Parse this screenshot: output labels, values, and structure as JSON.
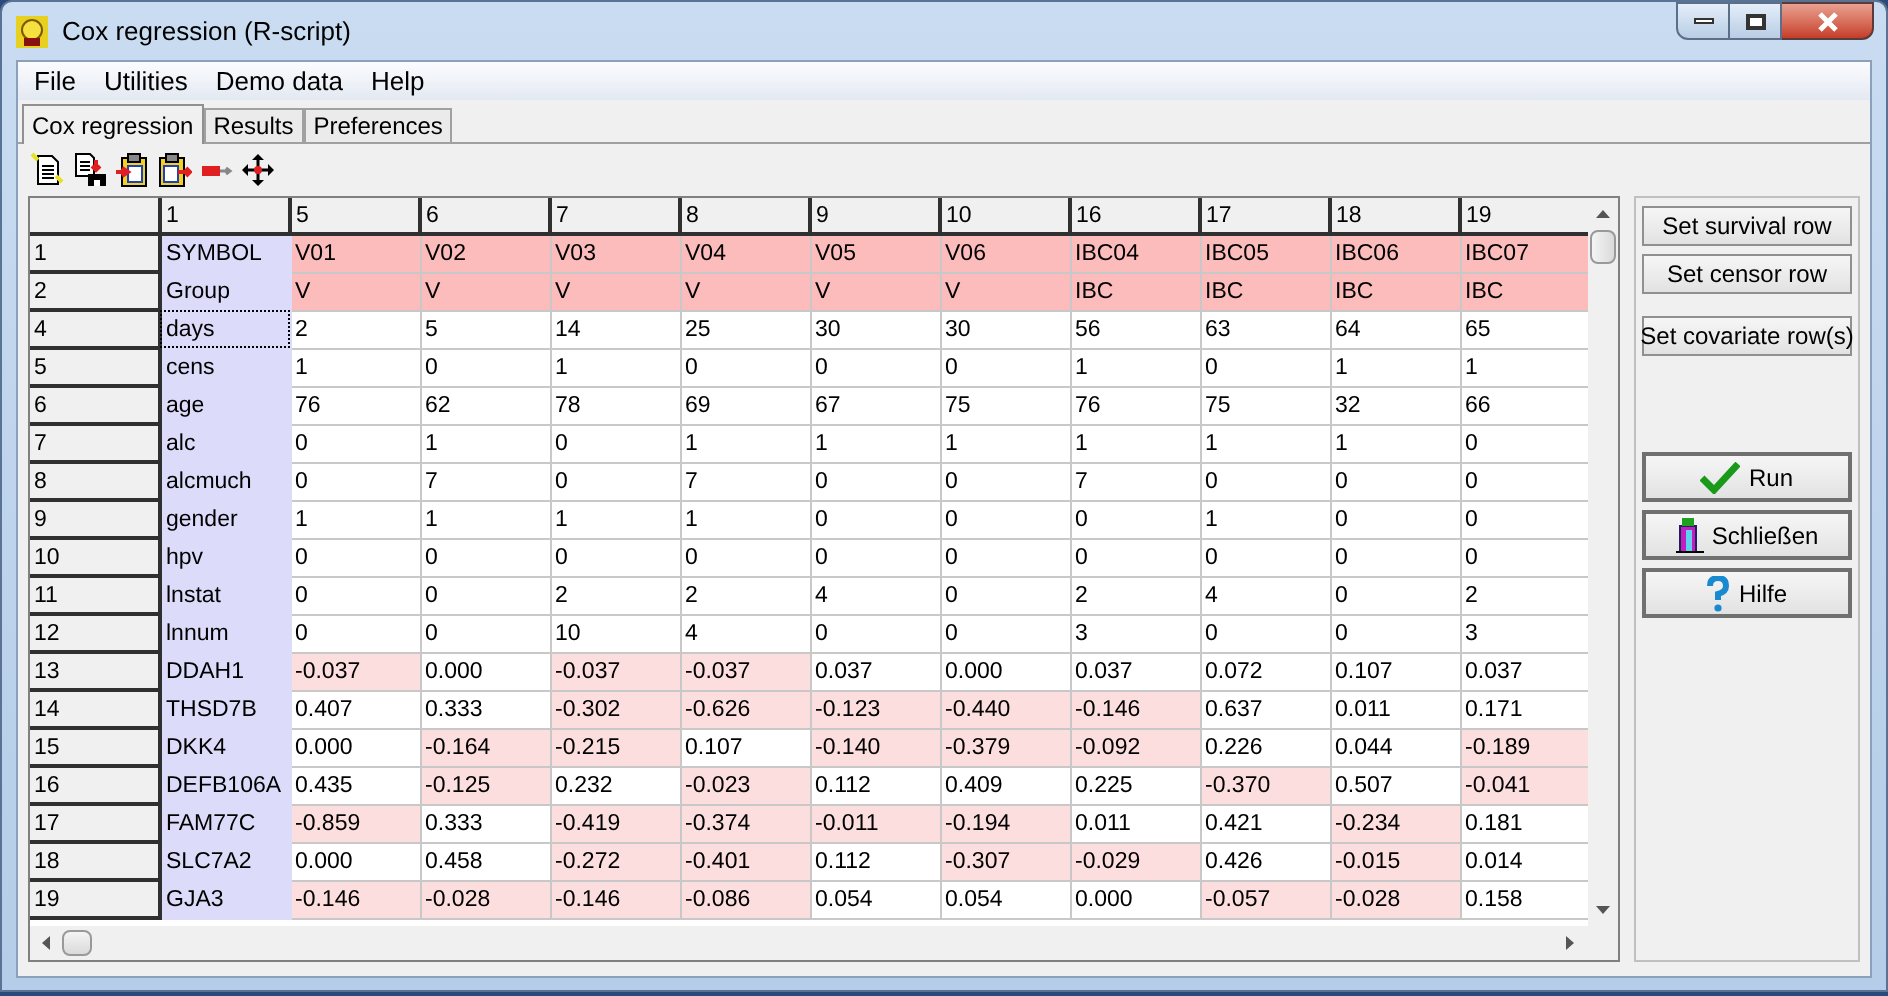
{
  "window": {
    "title": "Cox regression (R-script)"
  },
  "menu": [
    "File",
    "Utilities",
    "Demo data",
    "Help"
  ],
  "tabs": [
    {
      "label": "Cox regression",
      "selected": true
    },
    {
      "label": "Results",
      "selected": false
    },
    {
      "label": "Preferences",
      "selected": false
    }
  ],
  "grid": {
    "columns": [
      "1",
      "5",
      "6",
      "7",
      "8",
      "9",
      "10",
      "16",
      "17",
      "18",
      "19"
    ],
    "rows": [
      {
        "number": "1",
        "kind": "label",
        "cells": [
          "SYMBOL",
          "V01",
          "V02",
          "V03",
          "V04",
          "V05",
          "V06",
          "IBC04",
          "IBC05",
          "IBC06",
          "IBC07"
        ]
      },
      {
        "number": "2",
        "kind": "label",
        "cells": [
          "Group",
          "V",
          "V",
          "V",
          "V",
          "V",
          "V",
          "IBC",
          "IBC",
          "IBC",
          "IBC"
        ]
      },
      {
        "number": "4",
        "kind": "plain",
        "focused": true,
        "cells": [
          "days",
          "2",
          "5",
          "14",
          "25",
          "30",
          "30",
          "56",
          "63",
          "64",
          "65"
        ]
      },
      {
        "number": "5",
        "kind": "plain",
        "cells": [
          "cens",
          "1",
          "0",
          "1",
          "0",
          "0",
          "0",
          "1",
          "0",
          "1",
          "1"
        ]
      },
      {
        "number": "6",
        "kind": "plain",
        "cells": [
          "age",
          "76",
          "62",
          "78",
          "69",
          "67",
          "75",
          "76",
          "75",
          "32",
          "66"
        ]
      },
      {
        "number": "7",
        "kind": "plain",
        "cells": [
          "alc",
          "0",
          "1",
          "0",
          "1",
          "1",
          "1",
          "1",
          "1",
          "1",
          "0"
        ]
      },
      {
        "number": "8",
        "kind": "plain",
        "cells": [
          "alcmuch",
          "0",
          "7",
          "0",
          "7",
          "0",
          "0",
          "7",
          "0",
          "0",
          "0"
        ]
      },
      {
        "number": "9",
        "kind": "plain",
        "cells": [
          "gender",
          "1",
          "1",
          "1",
          "1",
          "0",
          "0",
          "0",
          "1",
          "0",
          "0"
        ]
      },
      {
        "number": "10",
        "kind": "plain",
        "cells": [
          "hpv",
          "0",
          "0",
          "0",
          "0",
          "0",
          "0",
          "0",
          "0",
          "0",
          "0"
        ]
      },
      {
        "number": "11",
        "kind": "plain",
        "cells": [
          "lnstat",
          "0",
          "0",
          "2",
          "2",
          "4",
          "0",
          "2",
          "4",
          "0",
          "2"
        ]
      },
      {
        "number": "12",
        "kind": "plain",
        "cells": [
          "lnnum",
          "0",
          "0",
          "10",
          "4",
          "0",
          "0",
          "3",
          "0",
          "0",
          "3"
        ]
      },
      {
        "number": "13",
        "kind": "value",
        "cells": [
          "DDAH1",
          {
            "text": "-0.037",
            "shaded": true
          },
          {
            "text": "0.000",
            "shaded": false
          },
          {
            "text": "-0.037",
            "shaded": true
          },
          {
            "text": "-0.037",
            "shaded": true
          },
          {
            "text": "0.037",
            "shaded": false
          },
          {
            "text": "0.000",
            "shaded": false
          },
          {
            "text": "0.037",
            "shaded": false
          },
          {
            "text": "0.072",
            "shaded": false
          },
          {
            "text": "0.107",
            "shaded": false
          },
          {
            "text": "0.037",
            "shaded": false
          }
        ]
      },
      {
        "number": "14",
        "kind": "value",
        "cells": [
          "THSD7B",
          {
            "text": "0.407",
            "shaded": false
          },
          {
            "text": "0.333",
            "shaded": false
          },
          {
            "text": "-0.302",
            "shaded": true
          },
          {
            "text": "-0.626",
            "shaded": true
          },
          {
            "text": "-0.123",
            "shaded": true
          },
          {
            "text": "-0.440",
            "shaded": true
          },
          {
            "text": "-0.146",
            "shaded": true
          },
          {
            "text": "0.637",
            "shaded": false
          },
          {
            "text": "0.011",
            "shaded": false
          },
          {
            "text": "0.171",
            "shaded": false
          }
        ]
      },
      {
        "number": "15",
        "kind": "value",
        "cells": [
          "DKK4",
          {
            "text": "0.000",
            "shaded": false
          },
          {
            "text": "-0.164",
            "shaded": true
          },
          {
            "text": "-0.215",
            "shaded": true
          },
          {
            "text": "0.107",
            "shaded": false
          },
          {
            "text": "-0.140",
            "shaded": true
          },
          {
            "text": "-0.379",
            "shaded": true
          },
          {
            "text": "-0.092",
            "shaded": true
          },
          {
            "text": "0.226",
            "shaded": false
          },
          {
            "text": "0.044",
            "shaded": false
          },
          {
            "text": "-0.189",
            "shaded": true
          }
        ]
      },
      {
        "number": "16",
        "kind": "value",
        "cells": [
          "DEFB106A",
          {
            "text": "0.435",
            "shaded": false
          },
          {
            "text": "-0.125",
            "shaded": true
          },
          {
            "text": "0.232",
            "shaded": false
          },
          {
            "text": "-0.023",
            "shaded": true
          },
          {
            "text": "0.112",
            "shaded": false
          },
          {
            "text": "0.409",
            "shaded": false
          },
          {
            "text": "0.225",
            "shaded": false
          },
          {
            "text": "-0.370",
            "shaded": true
          },
          {
            "text": "0.507",
            "shaded": false
          },
          {
            "text": "-0.041",
            "shaded": true
          }
        ]
      },
      {
        "number": "17",
        "kind": "value",
        "cells": [
          "FAM77C",
          {
            "text": "-0.859",
            "shaded": true
          },
          {
            "text": "0.333",
            "shaded": false
          },
          {
            "text": "-0.419",
            "shaded": true
          },
          {
            "text": "-0.374",
            "shaded": true
          },
          {
            "text": "-0.011",
            "shaded": true
          },
          {
            "text": "-0.194",
            "shaded": true
          },
          {
            "text": "0.011",
            "shaded": false
          },
          {
            "text": "0.421",
            "shaded": false
          },
          {
            "text": "-0.234",
            "shaded": true
          },
          {
            "text": "0.181",
            "shaded": false
          }
        ]
      },
      {
        "number": "18",
        "kind": "value",
        "cells": [
          "SLC7A2",
          {
            "text": "0.000",
            "shaded": false
          },
          {
            "text": "0.458",
            "shaded": false
          },
          {
            "text": "-0.272",
            "shaded": true
          },
          {
            "text": "-0.401",
            "shaded": true
          },
          {
            "text": "0.112",
            "shaded": false
          },
          {
            "text": "-0.307",
            "shaded": true
          },
          {
            "text": "-0.029",
            "shaded": true
          },
          {
            "text": "0.426",
            "shaded": false
          },
          {
            "text": "-0.015",
            "shaded": true
          },
          {
            "text": "0.014",
            "shaded": false
          }
        ]
      },
      {
        "number": "19",
        "kind": "value",
        "cells": [
          "GJA3",
          {
            "text": "-0.146",
            "shaded": true
          },
          {
            "text": "-0.028",
            "shaded": true
          },
          {
            "text": "-0.146",
            "shaded": true
          },
          {
            "text": "-0.086",
            "shaded": true
          },
          {
            "text": "0.054",
            "shaded": false
          },
          {
            "text": "0.054",
            "shaded": false
          },
          {
            "text": "0.000",
            "shaded": false
          },
          {
            "text": "-0.057",
            "shaded": true
          },
          {
            "text": "-0.028",
            "shaded": true
          },
          {
            "text": "0.158",
            "shaded": false
          }
        ]
      }
    ]
  },
  "side_buttons": [
    {
      "label": "Set survival row",
      "kind": "plain"
    },
    {
      "label": "Set censor row",
      "kind": "plain"
    },
    {
      "label": "Set covariate row(s)",
      "kind": "plain"
    },
    {
      "label": "Run",
      "kind": "run"
    },
    {
      "label": "Schließen",
      "kind": "close"
    },
    {
      "label": "Hilfe",
      "kind": "help"
    }
  ]
}
